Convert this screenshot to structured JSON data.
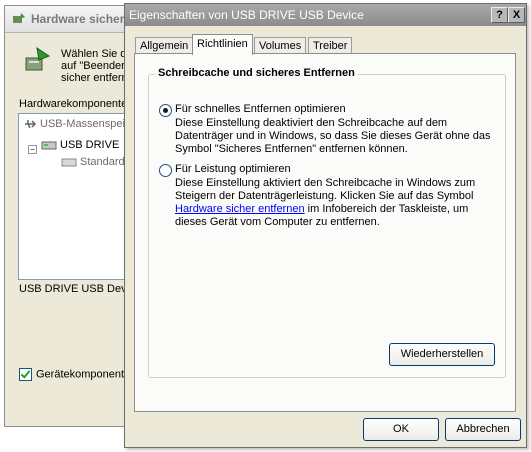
{
  "background_window": {
    "title": "Hardware sicher en",
    "intro_lines": "Wählen Sie d\nauf \"Beender\nsicher entfern",
    "list_label": "Hardwarekomponenter",
    "tree": [
      "USB-Massenspei",
      "USB DRIVE",
      "Standard"
    ],
    "device_label": "USB DRIVE USB Dev",
    "checkbox_label": "Gerätekomponente"
  },
  "dialog": {
    "title": "Eigenschaften von USB DRIVE USB Device",
    "help_button": "?",
    "close_button": "X",
    "tabs": [
      "Allgemein",
      "Richtlinien",
      "Volumes",
      "Treiber"
    ],
    "active_tab": "Richtlinien",
    "group_title": "Schreibcache und sicheres Entfernen",
    "option1": {
      "label": "Für schnelles Entfernen optimieren",
      "selected": true,
      "desc": [
        "Diese Einstellung deaktiviert den Schreibcache auf dem",
        "Datenträger und in Windows, so dass Sie dieses Gerät ohne das",
        "Symbol \"Sicheres Entfernen\" entfernen können."
      ]
    },
    "option2": {
      "label": "Für Leistung optimieren",
      "selected": false,
      "desc_line1": "Diese Einstellung aktiviert den Schreibcache in Windows zum",
      "desc_line2": "Steigern der Datenträgerleistung. Klicken Sie auf das Symbol",
      "desc_link": "Hardware sicher entfernen",
      "desc_line3_rest": " im Infobereich der Taskleiste, um",
      "desc_line4": "dieses Gerät vom Computer zu entfernen."
    },
    "restore_button": "Wiederherstellen",
    "ok_button": "OK",
    "cancel_button": "Abbrechen"
  },
  "colors": {
    "dialog_bg": "#ece9d8",
    "panel_bg": "#fbfbfa",
    "titlebar_inactive": "#9a9a9a",
    "link": "#0000ff"
  }
}
